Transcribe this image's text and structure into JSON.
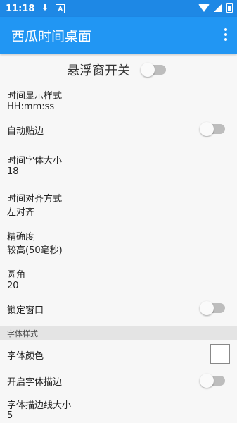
{
  "status_bar": {
    "time": "11:18"
  },
  "app_bar": {
    "title": "西瓜时间桌面"
  },
  "floating": {
    "label": "悬浮窗开关",
    "enabled": false
  },
  "settings": {
    "time_style": {
      "label": "时间显示样式",
      "value": "HH:mm:ss"
    },
    "auto_edge": {
      "label": "自动贴边",
      "enabled": false
    },
    "font_size": {
      "label": "时间字体大小",
      "value": "18"
    },
    "alignment": {
      "label": "时间对齐方式",
      "value": "左对齐"
    },
    "precision": {
      "label": "精确度",
      "value": "较高(50毫秒)"
    },
    "corner": {
      "label": "圆角",
      "value": "20"
    },
    "lock_window": {
      "label": "锁定窗口",
      "enabled": false
    }
  },
  "font_section": {
    "header": "字体样式",
    "font_color": {
      "label": "字体颜色",
      "color": "#ffffff"
    },
    "stroke": {
      "label": "开启字体描边",
      "enabled": false
    },
    "stroke_size": {
      "label": "字体描边线大小",
      "value": "5"
    }
  },
  "colors": {
    "primary": "#2196f3",
    "status": "#1e88e5"
  }
}
